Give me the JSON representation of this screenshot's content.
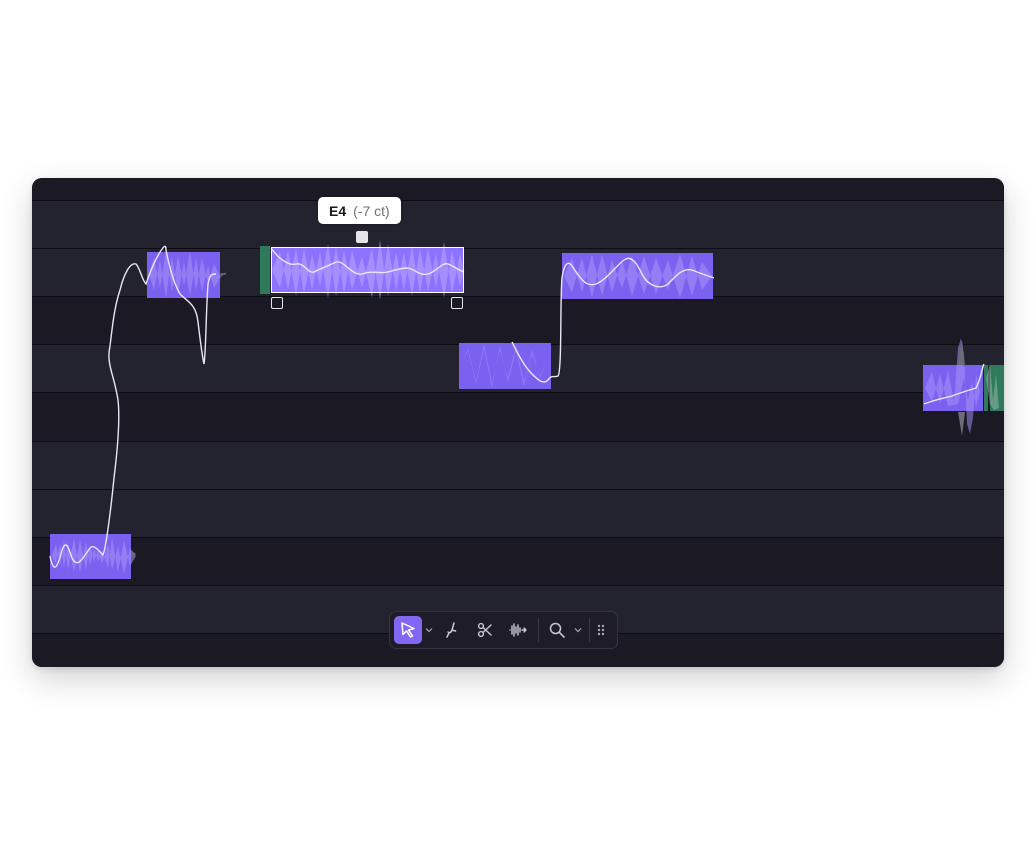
{
  "tooltip": {
    "pitch": "E4",
    "cents": "(-7 ct)"
  },
  "toolbar": {
    "tools": [
      {
        "name": "pointer-tool",
        "icon": "pointer-icon",
        "active": true
      },
      {
        "name": "pitch-tool",
        "icon": "tuning-fork-icon",
        "active": false
      },
      {
        "name": "split-tool",
        "icon": "scissors-icon",
        "active": false
      },
      {
        "name": "time-tool",
        "icon": "waveform-icon",
        "active": false
      },
      {
        "name": "zoom-tool",
        "icon": "magnifier-icon",
        "active": false
      }
    ]
  },
  "colors": {
    "note": "#7b61f0",
    "selected_note": "#8c72ff",
    "segment_marker": "#2f7a5a",
    "lane_light": "#23222f",
    "lane_dark": "#1a1924",
    "accent": "#8466f5"
  }
}
